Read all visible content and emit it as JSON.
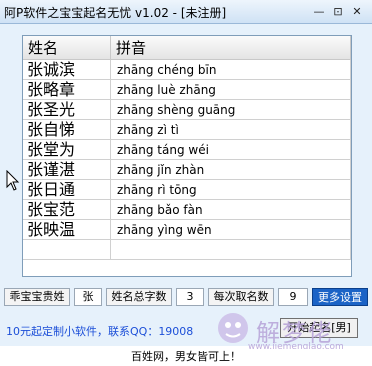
{
  "window": {
    "title": "阿P软件之宝宝起名无忧 v1.02 - [未注册]",
    "controls": {
      "minimize": "—",
      "maximize": "⊡",
      "close": "✕"
    }
  },
  "table": {
    "headers": {
      "name": "姓名",
      "pinyin": "拼音"
    },
    "rows": [
      {
        "name": "张诚滨",
        "pinyin": "zhāng chéng bīn"
      },
      {
        "name": "张略章",
        "pinyin": "zhāng luè zhāng"
      },
      {
        "name": "张圣光",
        "pinyin": "zhāng shèng guāng"
      },
      {
        "name": "张自悌",
        "pinyin": "zhāng zì tì"
      },
      {
        "name": "张堂为",
        "pinyin": "zhāng táng wéi"
      },
      {
        "name": "张谨湛",
        "pinyin": "zhāng jǐn zhàn"
      },
      {
        "name": "张日通",
        "pinyin": "zhāng rì tōng"
      },
      {
        "name": "张宝范",
        "pinyin": "zhāng bǎo fàn"
      },
      {
        "name": "张映温",
        "pinyin": "zhāng yìng wēn"
      }
    ]
  },
  "options": {
    "surname_label": "乖宝宝贵姓",
    "surname_value": "张",
    "total_chars_label": "姓名总字数",
    "total_chars_value": "3",
    "per_batch_label": "每次取名数",
    "per_batch_value": "9",
    "more_settings": "更多设置"
  },
  "promo_text": "10元起定制小软件，联系QQ：19008",
  "start_button": "开始起名[男]",
  "watermark": {
    "text": "解梦佬",
    "url": "www.jiemenglao.com"
  },
  "footer": "百姓网，男女皆可上！",
  "colors": {
    "promo": "#1c4fd8",
    "more_settings_bg": "#1b63c6",
    "window_bg": "#e6f1fb"
  }
}
